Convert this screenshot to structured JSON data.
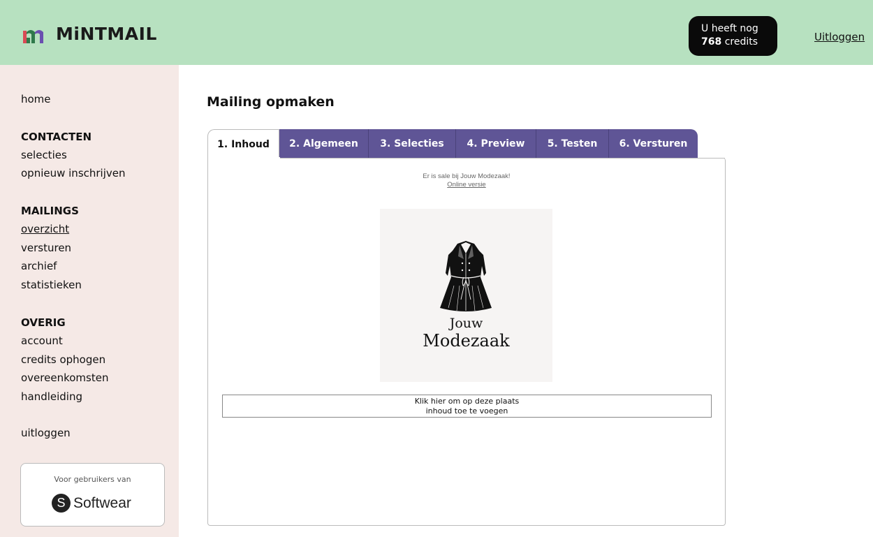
{
  "header": {
    "logo_icon": "mintmail-m-logo",
    "logo_text": "MiNTMAIL",
    "credits_line1": "U heeft nog",
    "credits_count": "768",
    "credits_unit": "credits",
    "logout_label": "Uitloggen"
  },
  "sidebar": {
    "home": "home",
    "contacts_heading": "CONTACTEN",
    "contacts_items": [
      "selecties",
      "opnieuw inschrijven"
    ],
    "mailings_heading": "MAILINGS",
    "mailings_items": [
      "overzicht",
      "versturen",
      "archief",
      "statistieken"
    ],
    "other_heading": "OVERIG",
    "other_items": [
      "account",
      "credits ophogen",
      "overeenkomsten",
      "handleiding"
    ],
    "logout": "uitloggen",
    "partner_caption": "Voor gebruikers van",
    "partner_logo_letter": "S",
    "partner_logo_text": "Softwear"
  },
  "main": {
    "title": "Mailing opmaken",
    "tabs": [
      "1. Inhoud",
      "2. Algemeen",
      "3. Selecties",
      "4. Preview",
      "5. Testen",
      "6. Versturen"
    ],
    "active_tab": "1. Inhoud",
    "preheader_text": "Er is sale bij Jouw Modezaak!",
    "online_version_link": "Online versie",
    "brand_icon": "coat-icon",
    "brand_line1": "Jouw",
    "brand_line2": "Modezaak",
    "add_content_line1": "Klik hier om op deze plaats",
    "add_content_line2": "inhoud toe te voegen"
  },
  "colors": {
    "header_bg": "#b7e1c0",
    "sidebar_bg": "#f5e9e6",
    "tab_bg": "#5f5596",
    "credits_bg": "#0a0a0a"
  }
}
